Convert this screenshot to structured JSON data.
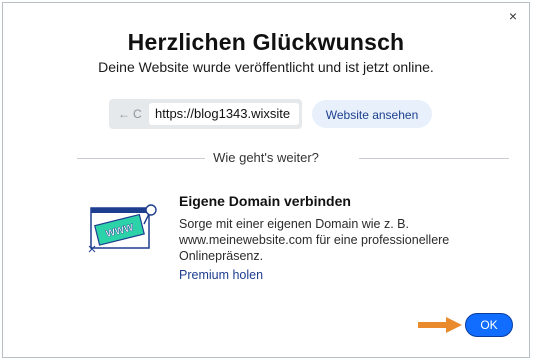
{
  "dialog": {
    "close_icon": "×",
    "title": "Herzlichen Glückwunsch",
    "subtitle": "Deine Website wurde veröffentlicht und ist jetzt online."
  },
  "browser_preview": {
    "back_icon": "←",
    "reload_icon": "C",
    "url": "https://blog1343.wixsite"
  },
  "view_site_button": "Website ansehen",
  "divider_text": "Wie geht's weiter?",
  "domain_card": {
    "illustration_text": "WWW",
    "title": "Eigene Domain verbinden",
    "description": "Sorge mit einer eigenen Domain wie z. B. www.meinewebsite.com für eine professionellere Onlinepräsenz.",
    "link": "Premium holen"
  },
  "ok_button": "OK",
  "colors": {
    "primary": "#116dff",
    "link": "#1d3d8f",
    "arrow": "#e98a2c",
    "illustration_green": "#2cd2a8"
  }
}
